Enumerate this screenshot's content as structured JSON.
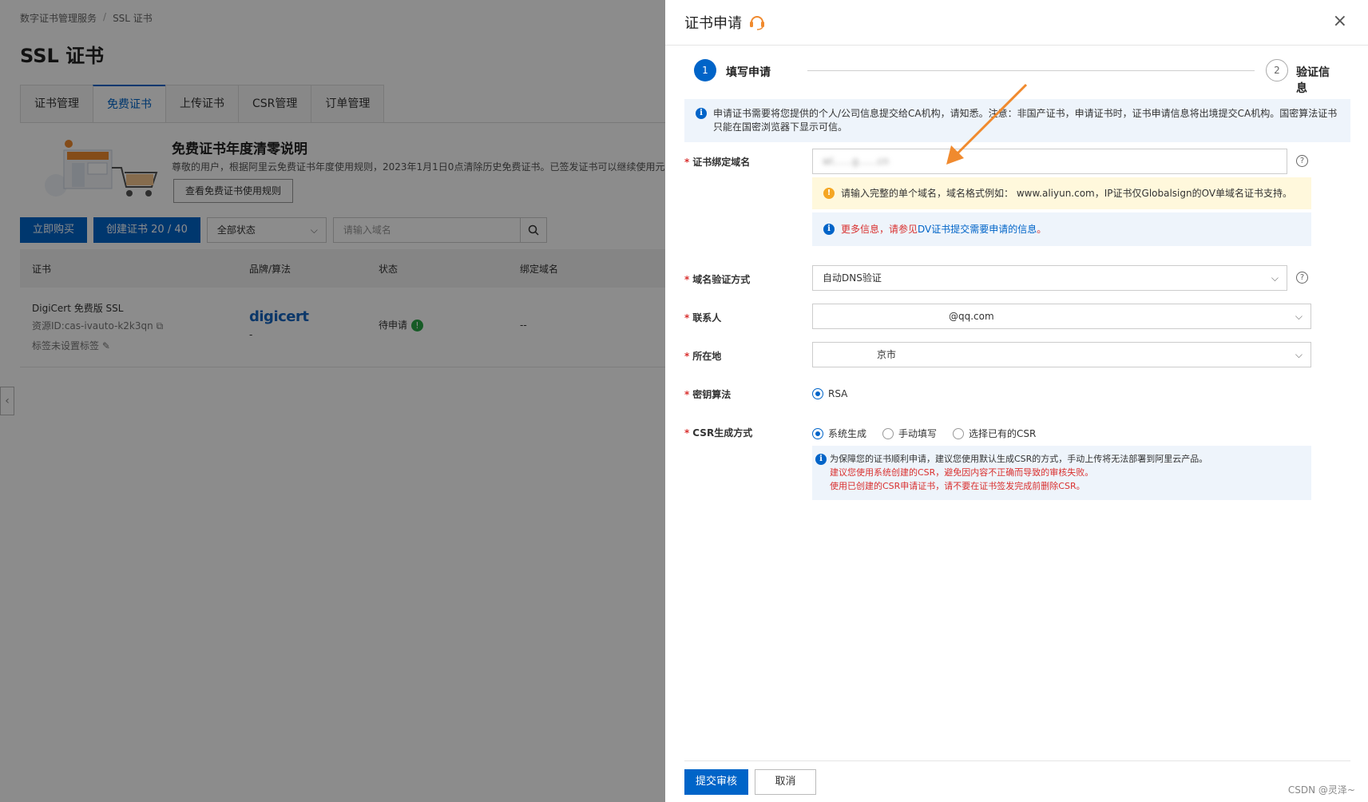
{
  "bg": {
    "breadcrumb": [
      "数字证书管理服务",
      "/",
      "SSL 证书"
    ],
    "title": "SSL 证书",
    "tabs": [
      "证书管理",
      "免费证书",
      "上传证书",
      "CSR管理",
      "订单管理"
    ],
    "notice": {
      "title": "免费证书年度清零说明",
      "text": "尊敬的用户，根据阿里云免费证书年度使用规则，2023年1月1日0点清除历史免费证书。已签发证书可以继续使用元生",
      "button": "查看免费证书使用规则"
    },
    "toolbar": {
      "buy": "立即购买",
      "create": "创建证书 20 / 40",
      "status_select": "全部状态",
      "search_placeholder": "请输入域名"
    },
    "table": {
      "headers": [
        "证书",
        "品牌/算法",
        "状态",
        "绑定域名"
      ],
      "row": {
        "name": "DigiCert 免费版 SSL",
        "resource": "资源ID:cas-ivauto-k2k3qn",
        "tag": "标签未设置标签",
        "brand": "digicert",
        "brand_sub": "-",
        "status": "待申请",
        "domain": "--"
      }
    }
  },
  "drawer": {
    "title": "证书申请",
    "close": "×",
    "steps": [
      {
        "num": "1",
        "label": "填写申请"
      },
      {
        "num": "2",
        "label": "验证信息"
      }
    ],
    "info_text": "申请证书需要将您提供的个人/公司信息提交给CA机构，请知悉。注意：非国产证书，申请证书时，证书申请信息将出境提交CA机构。国密算法证书只能在国密浏览器下显示可信。",
    "fields": {
      "domain": {
        "label": "证书绑定域名",
        "value": "wl……g……cn"
      },
      "domain_warn": "请输入完整的单个域名，域名格式例如：  www.aliyun.com，IP证书仅Globalsign的OV单域名证书支持。",
      "more_info_prefix": "更多信息，请参见",
      "more_info_link": "DV证书提交需要申请的信息",
      "more_info_suffix": "。",
      "verify": {
        "label": "域名验证方式",
        "value": "自动DNS验证"
      },
      "contact": {
        "label": "联系人",
        "value": "@qq.com"
      },
      "location": {
        "label": "所在地",
        "value": "京市"
      },
      "key_algo": {
        "label": "密钥算法",
        "option": "RSA"
      },
      "csr": {
        "label": "CSR生成方式",
        "options": [
          "系统生成",
          "手动填写",
          "选择已有的CSR"
        ],
        "note1": "为保障您的证书顺利申请，建议您使用默认生成CSR的方式，手动上传将无法部署到阿里云产品。",
        "note2": "建议您使用系统创建的CSR，避免因内容不正确而导致的审核失败。",
        "note3": "使用已创建的CSR申请证书，请不要在证书签发完成前删除CSR。"
      }
    },
    "submit": "提交审核",
    "cancel": "取消",
    "watermark": "CSDN @灵泽~"
  },
  "colors": {
    "primary": "#0064c8",
    "danger": "#d9302f",
    "warning": "#f5a623",
    "annotation_arrow": "#f08a2e"
  }
}
